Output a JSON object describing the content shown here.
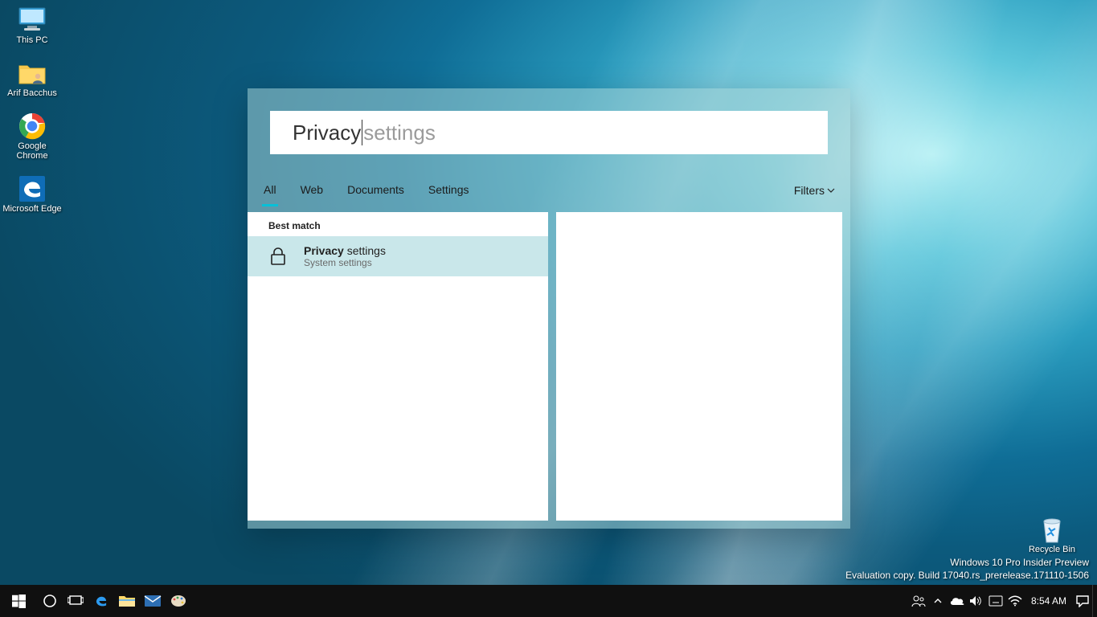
{
  "desktop": {
    "icons": [
      {
        "label": "This PC"
      },
      {
        "label": "Arif Bacchus"
      },
      {
        "label": "Google Chrome"
      },
      {
        "label": "Microsoft Edge"
      }
    ],
    "recycle": {
      "label": "Recycle Bin"
    }
  },
  "search": {
    "typed": "Privacy",
    "suggestion": " settings",
    "tabs": [
      "All",
      "Web",
      "Documents",
      "Settings"
    ],
    "activeTab": "All",
    "filtersLabel": "Filters",
    "bestMatchHeader": "Best match",
    "result": {
      "titleBold": "Privacy",
      "titleRest": " settings",
      "subtitle": "System settings"
    }
  },
  "watermark": {
    "line1": "Windows 10 Pro Insider Preview",
    "line2": "Evaluation copy. Build 17040.rs_prerelease.171110-1506"
  },
  "taskbar": {
    "clock": "8:54 AM"
  }
}
